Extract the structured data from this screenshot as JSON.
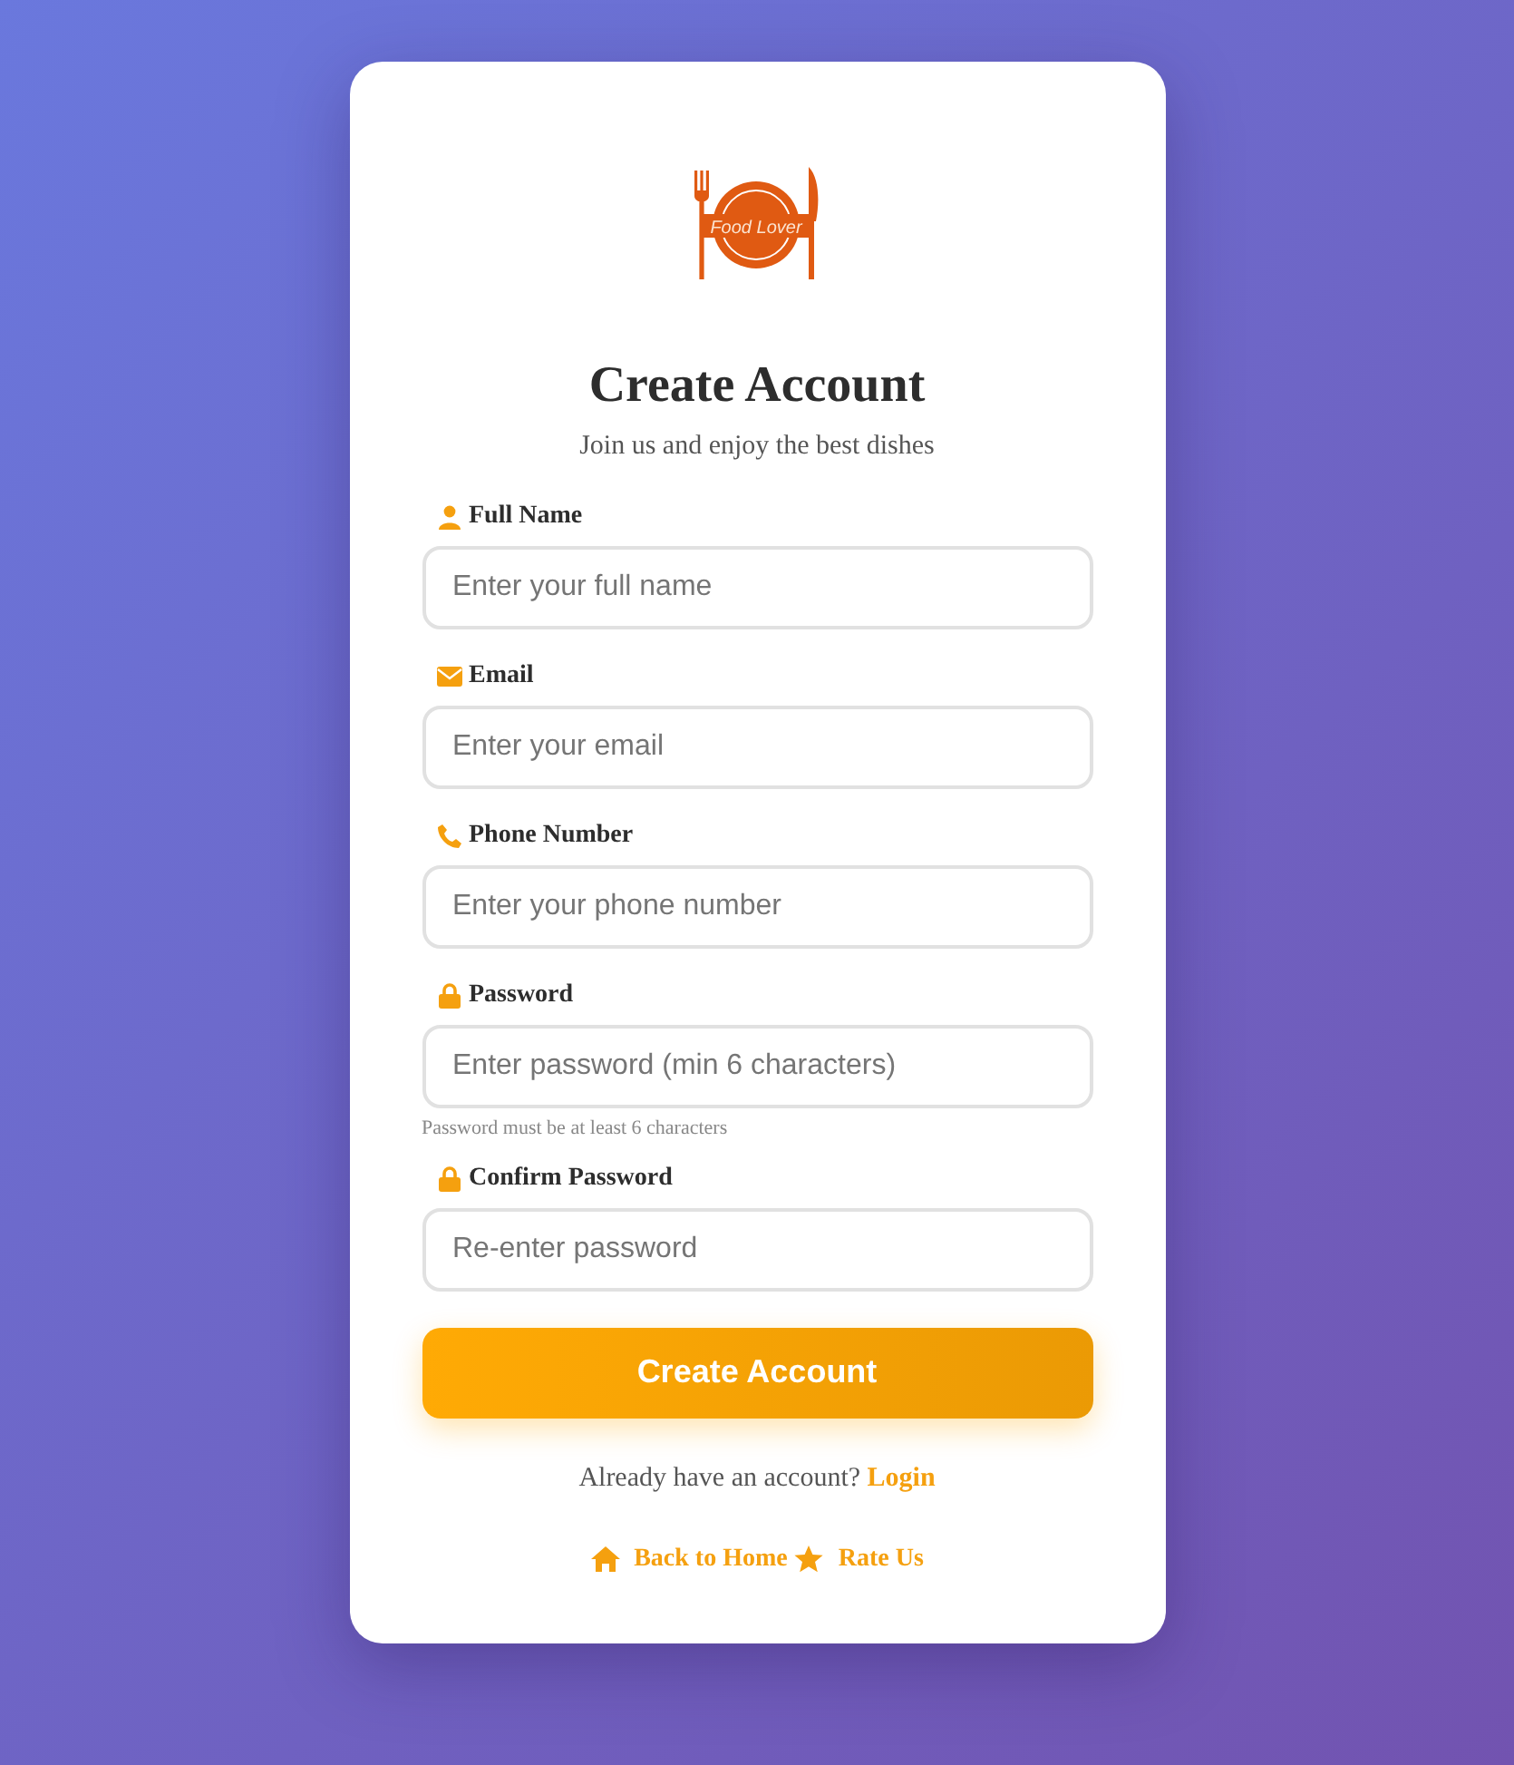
{
  "logo": {
    "text": "Food Lover"
  },
  "title": "Create Account",
  "subtitle": "Join us and enjoy the best dishes",
  "fields": [
    {
      "kind": "person",
      "label": "Full Name",
      "placeholder": "Enter your full name"
    },
    {
      "kind": "email",
      "label": "Email",
      "placeholder": "Enter your email"
    },
    {
      "kind": "phone",
      "label": "Phone Number",
      "placeholder": "Enter your phone number"
    },
    {
      "kind": "lock",
      "label": "Password",
      "placeholder": "Enter password (min 6 characters)",
      "hint": "Password must be at least 6 characters"
    },
    {
      "kind": "lock",
      "label": "Confirm Password",
      "placeholder": "Re-enter password"
    }
  ],
  "submit": "Create Account",
  "login_prompt": {
    "text": "Already have an account?",
    "link": "Login"
  },
  "footer_links": [
    {
      "kind": "home",
      "label": "Back to Home"
    },
    {
      "kind": "star",
      "label": "Rate Us"
    }
  ]
}
